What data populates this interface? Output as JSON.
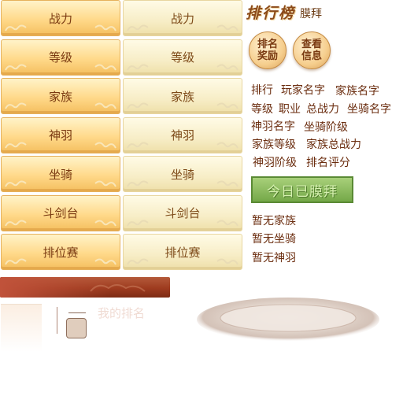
{
  "title": {
    "main": "排行榜",
    "sub": "膜拜"
  },
  "tabs_left": [
    "战力",
    "等级",
    "家族",
    "神羽",
    "坐骑",
    "斗剑台",
    "排位赛"
  ],
  "tabs_right": [
    "战力",
    "等级",
    "家族",
    "神羽",
    "坐骑",
    "斗剑台",
    "排位赛"
  ],
  "buttons": {
    "rank_reward": "排名奖励",
    "view_info": "查看信息",
    "today_worshipped": "今日已膜拜"
  },
  "info_labels": {
    "rank": "排行",
    "player_name": "玩家名字",
    "family_name": "家族名字",
    "level": "等级",
    "job": "职业",
    "total_power": "总战力",
    "mount_name": "坐骑名字",
    "wing_name": "神羽名字",
    "mount_stage": "坐骑阶级",
    "family_level": "家族等级",
    "family_total_power": "家族总战力",
    "wing_stage": "神羽阶级",
    "rank_score": "排名评分"
  },
  "empty_states": {
    "no_family": "暂无家族",
    "no_mount": "暂无坐骑",
    "no_wing": "暂无神羽"
  },
  "my_rank_label": "我的排名",
  "colors": {
    "accent": "#8b4a1a",
    "tab_gold": "#ffd98a",
    "tab_cream": "#f7edc6",
    "green_button": "#74a848",
    "red_bar": "#9e3b1f"
  }
}
